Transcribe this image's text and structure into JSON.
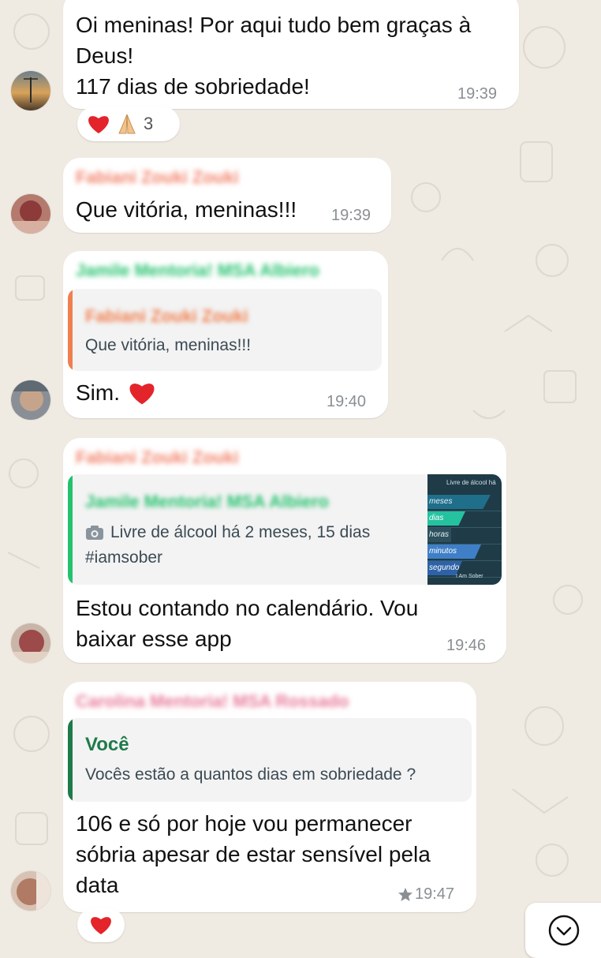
{
  "colors": {
    "background": "#efeae2",
    "bubble": "#ffffff",
    "time": "#8a8f93",
    "heart": "#e3242b",
    "quote_orange": "#f07f4f",
    "quote_green": "#1f7a4a",
    "sender_salmon": "#f2836b",
    "sender_green": "#25c26e",
    "sender_pink": "#e87a9a"
  },
  "messages": [
    {
      "text_lines": [
        "Oi meninas! Por aqui tudo bem graças à",
        "Deus!",
        "117 dias de sobriedade!"
      ],
      "time": "19:39",
      "reaction": {
        "emojis": [
          "red-heart",
          "folded-hands"
        ],
        "count": "3"
      }
    },
    {
      "sender": "Fabiani Zouki Zouki",
      "text": "Que vitória, meninas!!!",
      "time": "19:39"
    },
    {
      "sender": "Jamile Mentoria! MSA Albiero",
      "quote": {
        "name": "Fabiani Zouki Zouki",
        "text": "Que vitória, meninas!!!"
      },
      "text": "Sim.",
      "time": "19:40"
    },
    {
      "sender": "Fabiani Zouki Zouki",
      "quote": {
        "name": "Jamile Mentoria! MSA Albiero",
        "icon": "camera-icon",
        "text_line1": "Livre de álcool há 2 meses, 15 dias",
        "text_line2": "#iamsober",
        "thumb": {
          "title": "Livre de álcool há",
          "rows": [
            "meses",
            "dias",
            "horas",
            "minutos",
            "segundos"
          ],
          "footer": "I Am Sober"
        }
      },
      "text_lines": [
        "Estou contando no calendário. Vou",
        "baixar esse app"
      ],
      "time": "19:46"
    },
    {
      "sender": "Carolina Mentoria! MSA Rossado",
      "quote": {
        "name": "Você",
        "text": "Vocês estão a quantos dias em sobriedade ?"
      },
      "text_lines": [
        "106 e só por hoje vou permanecer",
        "sóbria apesar de estar sensível pela",
        "data"
      ],
      "time": "19:47",
      "starred": true,
      "reaction": {
        "emojis": [
          "red-heart"
        ]
      }
    }
  ]
}
